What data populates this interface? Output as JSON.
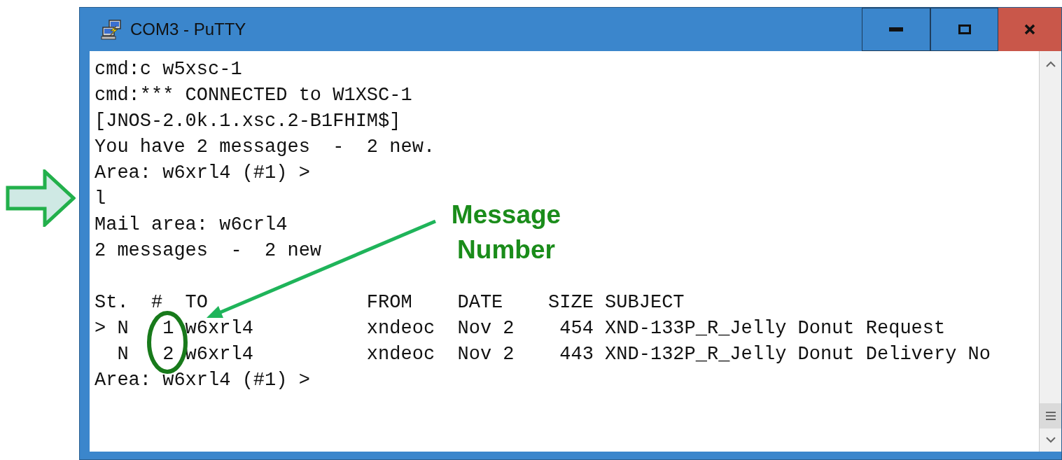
{
  "window": {
    "title": "COM3 - PuTTY"
  },
  "terminal": {
    "lines": [
      "cmd:c w5xsc-1",
      "cmd:*** CONNECTED to W1XSC-1",
      "[JNOS-2.0k.1.xsc.2-B1FHIM$]",
      "You have 2 messages  -  2 new.",
      "Area: w6xrl4 (#1) >",
      "l",
      "Mail area: w6crl4",
      "2 messages  -  2 new"
    ],
    "listing": {
      "header": "St.  #  TO              FROM    DATE    SIZE SUBJECT",
      "rows": [
        "> N   1 w6xrl4          xndeoc  Nov 2    454 XND-133P_R_Jelly Donut Request",
        "  N   2 w6xrl4          xndeoc  Nov 2    443 XND-132P_R_Jelly Donut Delivery No"
      ]
    },
    "prompt": "Area: w6xrl4 (#1) >"
  },
  "annotation": {
    "label": "Message Number"
  }
}
